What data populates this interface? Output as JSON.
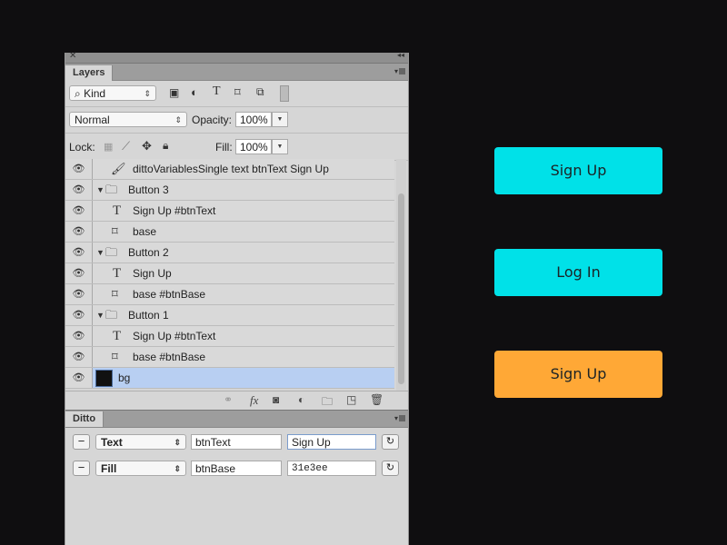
{
  "layers_panel": {
    "tab_label": "Layers",
    "filter": {
      "value": "Kind"
    },
    "filter_icons": [
      "image-filter-icon",
      "adjustment-filter-icon",
      "type-filter-icon",
      "shape-filter-icon",
      "smart-object-filter-icon",
      "filter-toggle-icon"
    ],
    "blend_mode": "Normal",
    "opacity_label": "Opacity:",
    "opacity_value": "100%",
    "lock_label": "Lock:",
    "fill_label": "Fill:",
    "fill_value": "100%",
    "layers": [
      {
        "name": "dittoVariablesSingle text btnText Sign Up",
        "type": "brush",
        "indent": 1
      },
      {
        "name": "Button 3",
        "type": "group",
        "indent": 0
      },
      {
        "name": "Sign Up #btnText",
        "type": "text",
        "indent": 1
      },
      {
        "name": "base",
        "type": "shape",
        "indent": 1
      },
      {
        "name": "Button 2",
        "type": "group",
        "indent": 0
      },
      {
        "name": "Sign Up",
        "type": "text",
        "indent": 1
      },
      {
        "name": "base #btnBase",
        "type": "shape",
        "indent": 1
      },
      {
        "name": "Button 1",
        "type": "group",
        "indent": 0
      },
      {
        "name": "Sign Up #btnText",
        "type": "text",
        "indent": 1
      },
      {
        "name": "base #btnBase",
        "type": "shape",
        "indent": 1
      },
      {
        "name": "bg",
        "type": "fill",
        "indent": 0,
        "selected": true
      }
    ],
    "footer_icons": [
      "link-icon",
      "fx-icon",
      "mask-icon",
      "adjustment-icon",
      "new-group-icon",
      "new-layer-icon",
      "trash-icon"
    ]
  },
  "ditto_panel": {
    "tab_label": "Ditto",
    "rows": [
      {
        "property": "Text",
        "variable": "btnText",
        "value": "Sign Up"
      },
      {
        "property": "Fill",
        "variable": "btnBase",
        "value": "31e3ee"
      }
    ]
  },
  "canvas": {
    "buttons": [
      {
        "label": "Sign Up",
        "color": "#00e1e8"
      },
      {
        "label": "Log In",
        "color": "#00e1e8"
      },
      {
        "label": "Sign Up",
        "color": "#ffa836"
      }
    ]
  }
}
